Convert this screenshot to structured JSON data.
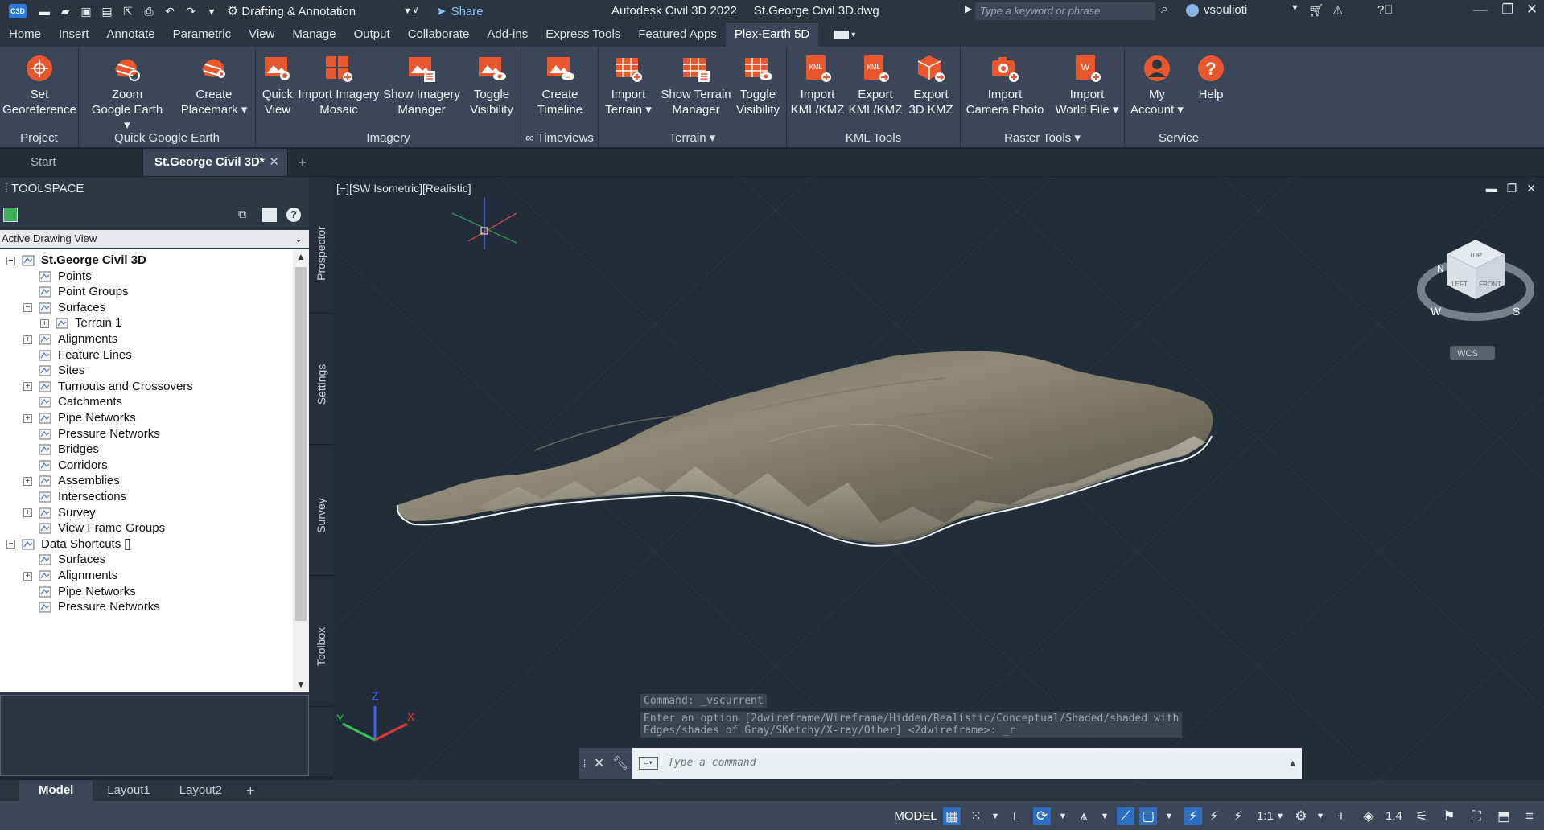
{
  "titlebar": {
    "logo": "C3D",
    "workspace": "Drafting & Annotation",
    "share": "Share",
    "app_title": "Autodesk Civil 3D 2022",
    "file_name": "St.George Civil 3D.dwg",
    "search_placeholder": "Type a keyword or phrase",
    "username": "vsoulioti"
  },
  "menu_tabs": [
    "Home",
    "Insert",
    "Annotate",
    "Parametric",
    "View",
    "Manage",
    "Output",
    "Collaborate",
    "Add-ins",
    "Express Tools",
    "Featured Apps",
    "Plex-Earth 5D"
  ],
  "active_tab": "Plex-Earth 5D",
  "ribbon": {
    "project": {
      "title": "Project",
      "set_georeference": [
        "Set",
        "Georeference"
      ]
    },
    "quick_google_earth": {
      "title": "Quick Google Earth",
      "zoom": [
        "Zoom",
        "Google Earth"
      ],
      "placemark": [
        "Create",
        "Placemark"
      ]
    },
    "imagery": {
      "title": "Imagery",
      "quick_view": [
        "Quick",
        "View"
      ],
      "import_mosaic": [
        "Import Imagery",
        "Mosaic"
      ],
      "show_manager": [
        "Show Imagery",
        "Manager"
      ],
      "toggle": [
        "Toggle",
        "Visibility"
      ]
    },
    "timeviews": {
      "title": "∞ Timeviews",
      "create_timeline": [
        "Create",
        "Timeline"
      ]
    },
    "terrain": {
      "title": "Terrain",
      "import_terrain": [
        "Import",
        "Terrain"
      ],
      "show_terrain_manager": [
        "Show Terrain",
        "Manager"
      ],
      "toggle": [
        "Toggle",
        "Visibility"
      ]
    },
    "kml_tools": {
      "title": "KML Tools",
      "import_kml": [
        "Import",
        "KML/KMZ"
      ],
      "export_kml": [
        "Export",
        "KML/KMZ"
      ],
      "export_3d": [
        "Export",
        "3D KMZ"
      ]
    },
    "raster_tools": {
      "title": "Raster Tools",
      "import_camera": [
        "Import",
        "Camera Photo"
      ],
      "import_world": [
        "Import",
        "World File"
      ]
    },
    "service": {
      "title": "Service",
      "account": [
        "My",
        "Account"
      ],
      "help": [
        "Help"
      ]
    }
  },
  "doc_tabs": {
    "start": "Start",
    "active": "St.George Civil 3D*"
  },
  "toolspace": {
    "header": "TOOLSPACE",
    "view_select": "Active Drawing View",
    "side_tabs": [
      "Prospector",
      "Settings",
      "Survey",
      "Toolbox"
    ],
    "tree": [
      {
        "label": "St.George Civil 3D",
        "level": 0,
        "exp": "−",
        "icon": "drawing-icon",
        "bold": true
      },
      {
        "label": "Points",
        "level": 1,
        "exp": "",
        "icon": "points-icon"
      },
      {
        "label": "Point Groups",
        "level": 1,
        "exp": "",
        "icon": "point-groups-icon"
      },
      {
        "label": "Surfaces",
        "level": 1,
        "exp": "−",
        "icon": "surfaces-icon"
      },
      {
        "label": "Terrain 1",
        "level": 2,
        "exp": "+",
        "icon": "terrain-icon"
      },
      {
        "label": "Alignments",
        "level": 1,
        "exp": "+",
        "icon": "alignments-icon"
      },
      {
        "label": "Feature Lines",
        "level": 1,
        "exp": "",
        "icon": "feature-lines-icon"
      },
      {
        "label": "Sites",
        "level": 1,
        "exp": "",
        "icon": "sites-icon"
      },
      {
        "label": "Turnouts and Crossovers",
        "level": 1,
        "exp": "+",
        "icon": "turnouts-icon"
      },
      {
        "label": "Catchments",
        "level": 1,
        "exp": "",
        "icon": "catchments-icon"
      },
      {
        "label": "Pipe Networks",
        "level": 1,
        "exp": "+",
        "icon": "pipe-networks-icon"
      },
      {
        "label": "Pressure Networks",
        "level": 1,
        "exp": "",
        "icon": "pressure-networks-icon"
      },
      {
        "label": "Bridges",
        "level": 1,
        "exp": "",
        "icon": "bridges-icon"
      },
      {
        "label": "Corridors",
        "level": 1,
        "exp": "",
        "icon": "corridors-icon"
      },
      {
        "label": "Assemblies",
        "level": 1,
        "exp": "+",
        "icon": "assemblies-icon"
      },
      {
        "label": "Intersections",
        "level": 1,
        "exp": "",
        "icon": "intersections-icon"
      },
      {
        "label": "Survey",
        "level": 1,
        "exp": "+",
        "icon": "survey-icon"
      },
      {
        "label": "View Frame Groups",
        "level": 1,
        "exp": "",
        "icon": "view-frame-groups-icon"
      },
      {
        "label": "Data Shortcuts []",
        "level": 0,
        "exp": "−",
        "icon": "data-shortcuts-icon"
      },
      {
        "label": "Surfaces",
        "level": 1,
        "exp": "",
        "icon": "surfaces-icon"
      },
      {
        "label": "Alignments",
        "level": 1,
        "exp": "+",
        "icon": "alignments-icon"
      },
      {
        "label": "Pipe Networks",
        "level": 1,
        "exp": "",
        "icon": "pipe-networks-icon"
      },
      {
        "label": "Pressure Networks",
        "level": 1,
        "exp": "",
        "icon": "pressure-networks-icon"
      }
    ]
  },
  "viewport": {
    "label": "[−][SW Isometric][Realistic]",
    "viewcube": {
      "top": "TOP",
      "left": "LEFT",
      "front": "FRONT",
      "wcs": "WCS",
      "n": "N",
      "w": "W",
      "s": "S"
    },
    "axis": {
      "x": "X",
      "y": "Y",
      "z": "Z"
    }
  },
  "command": {
    "history_1": "Command: _vscurrent",
    "history_2": "Enter an option [2dwireframe/Wireframe/Hidden/Realistic/Conceptual/Shaded/shaded with",
    "history_3": "Edges/shades of Gray/SKetchy/X-ray/Other] <2dwireframe>: _r",
    "placeholder": "Type a command"
  },
  "layout_tabs": [
    "Model",
    "Layout1",
    "Layout2"
  ],
  "active_layout": "Model",
  "statusbar": {
    "model": "MODEL",
    "scale": "1:1",
    "annot": "1.4"
  },
  "colors": {
    "accent": "#e8572d",
    "ribbon_bg": "#3b4758",
    "titlebar_bg": "#2b3542",
    "viewport_bg": "#232d3a"
  }
}
